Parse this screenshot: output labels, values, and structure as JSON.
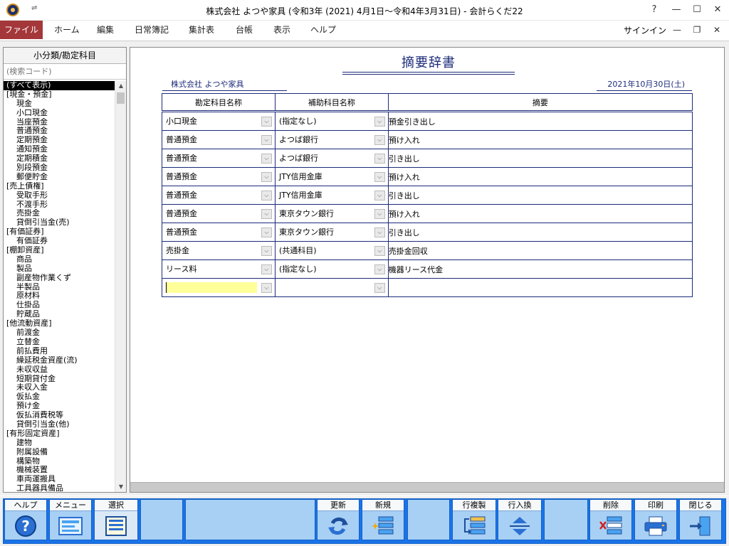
{
  "window": {
    "title": "株式会社 よつや家具 (令和3年 (2021) 4月1日～令和4年3月31日) - 会計らくだ22",
    "qat_glyph": "⇌",
    "controls": [
      "?",
      "—",
      "☐",
      "✕"
    ]
  },
  "menu": {
    "items": [
      "ファイル",
      "ホーム",
      "編集",
      "日常簿記",
      "集計表",
      "台帳",
      "表示",
      "ヘルプ"
    ],
    "signin": "サインイン",
    "mdi_controls": [
      "—",
      "❐",
      "✕"
    ]
  },
  "sidebar": {
    "header": "小分類/勘定科目",
    "search_placeholder": "(検索コード)",
    "items": [
      {
        "label": "(すべて表示)",
        "type": "sel"
      },
      {
        "label": "[現金・預金]",
        "type": "cat"
      },
      {
        "label": "現金",
        "type": "acct"
      },
      {
        "label": "小口現金",
        "type": "acct"
      },
      {
        "label": "当座預金",
        "type": "acct"
      },
      {
        "label": "普通預金",
        "type": "acct"
      },
      {
        "label": "定期預金",
        "type": "acct"
      },
      {
        "label": "通知預金",
        "type": "acct"
      },
      {
        "label": "定期積金",
        "type": "acct"
      },
      {
        "label": "別段預金",
        "type": "acct"
      },
      {
        "label": "郵便貯金",
        "type": "acct"
      },
      {
        "label": "[売上債権]",
        "type": "cat"
      },
      {
        "label": "受取手形",
        "type": "acct"
      },
      {
        "label": "不渡手形",
        "type": "acct"
      },
      {
        "label": "売掛金",
        "type": "acct"
      },
      {
        "label": "貸倒引当金(売)",
        "type": "acct"
      },
      {
        "label": "[有価証券]",
        "type": "cat"
      },
      {
        "label": "有価証券",
        "type": "acct"
      },
      {
        "label": "[棚卸資産]",
        "type": "cat"
      },
      {
        "label": "商品",
        "type": "acct"
      },
      {
        "label": "製品",
        "type": "acct"
      },
      {
        "label": "副産物作業くず",
        "type": "acct"
      },
      {
        "label": "半製品",
        "type": "acct"
      },
      {
        "label": "原材料",
        "type": "acct"
      },
      {
        "label": "仕掛品",
        "type": "acct"
      },
      {
        "label": "貯蔵品",
        "type": "acct"
      },
      {
        "label": "[他流動資産]",
        "type": "cat"
      },
      {
        "label": "前渡金",
        "type": "acct"
      },
      {
        "label": "立替金",
        "type": "acct"
      },
      {
        "label": "前払費用",
        "type": "acct"
      },
      {
        "label": "繰延税金資産(流)",
        "type": "acct"
      },
      {
        "label": "未収収益",
        "type": "acct"
      },
      {
        "label": "短期貸付金",
        "type": "acct"
      },
      {
        "label": "未収入金",
        "type": "acct"
      },
      {
        "label": "仮払金",
        "type": "acct"
      },
      {
        "label": "預け金",
        "type": "acct"
      },
      {
        "label": "仮払消費税等",
        "type": "acct"
      },
      {
        "label": "貸倒引当金(他)",
        "type": "acct"
      },
      {
        "label": "[有形固定資産]",
        "type": "cat"
      },
      {
        "label": "建物",
        "type": "acct"
      },
      {
        "label": "附属設備",
        "type": "acct"
      },
      {
        "label": "構築物",
        "type": "acct"
      },
      {
        "label": "機械装置",
        "type": "acct"
      },
      {
        "label": "車両運搬具",
        "type": "acct"
      },
      {
        "label": "工具器具備品",
        "type": "acct"
      }
    ]
  },
  "document": {
    "title": "摘要辞書",
    "company": "株式会社 よつや家具",
    "date": "2021年10月30日(土)",
    "columns": [
      "勘定科目名称",
      "補助科目名称",
      "摘要"
    ],
    "rows": [
      [
        "小口現金",
        "(指定なし)",
        "預金引き出し"
      ],
      [
        "普通預金",
        "よつば銀行",
        "預け入れ"
      ],
      [
        "普通預金",
        "よつば銀行",
        "引き出し"
      ],
      [
        "普通預金",
        "JTY信用金庫",
        "預け入れ"
      ],
      [
        "普通預金",
        "JTY信用金庫",
        "引き出し"
      ],
      [
        "普通預金",
        "東京タウン銀行",
        "預け入れ"
      ],
      [
        "普通預金",
        "東京タウン銀行",
        "引き出し"
      ],
      [
        "売掛金",
        "(共通科目)",
        "売掛金回収"
      ],
      [
        "リース料",
        "(指定なし)",
        "機器リース代金"
      ],
      [
        "",
        "",
        ""
      ]
    ]
  },
  "toolbar": {
    "buttons": [
      {
        "label": "ヘルプ",
        "icon": "help-icon"
      },
      {
        "label": "メニュー",
        "icon": "menu-icon"
      },
      {
        "label": "選択",
        "icon": "select-icon"
      },
      {
        "label": "",
        "icon": ""
      },
      {
        "label": "",
        "icon": ""
      },
      {
        "label": "更新",
        "icon": "refresh-icon"
      },
      {
        "label": "新規",
        "icon": "new-icon"
      },
      {
        "label": "",
        "icon": ""
      },
      {
        "label": "行複製",
        "icon": "duplicate-row-icon"
      },
      {
        "label": "行入換",
        "icon": "swap-rows-icon"
      },
      {
        "label": "",
        "icon": ""
      },
      {
        "label": "削除",
        "icon": "delete-icon"
      },
      {
        "label": "印刷",
        "icon": "print-icon"
      },
      {
        "label": "閉じる",
        "icon": "close-icon"
      }
    ]
  },
  "colors": {
    "file_menu_bg": "#a4373a",
    "toolbar_frame": "#1a73e8",
    "toolbar_button": "#a8d0f5",
    "doc_ink": "#1c2b7a",
    "active_cell": "#ffff99"
  }
}
